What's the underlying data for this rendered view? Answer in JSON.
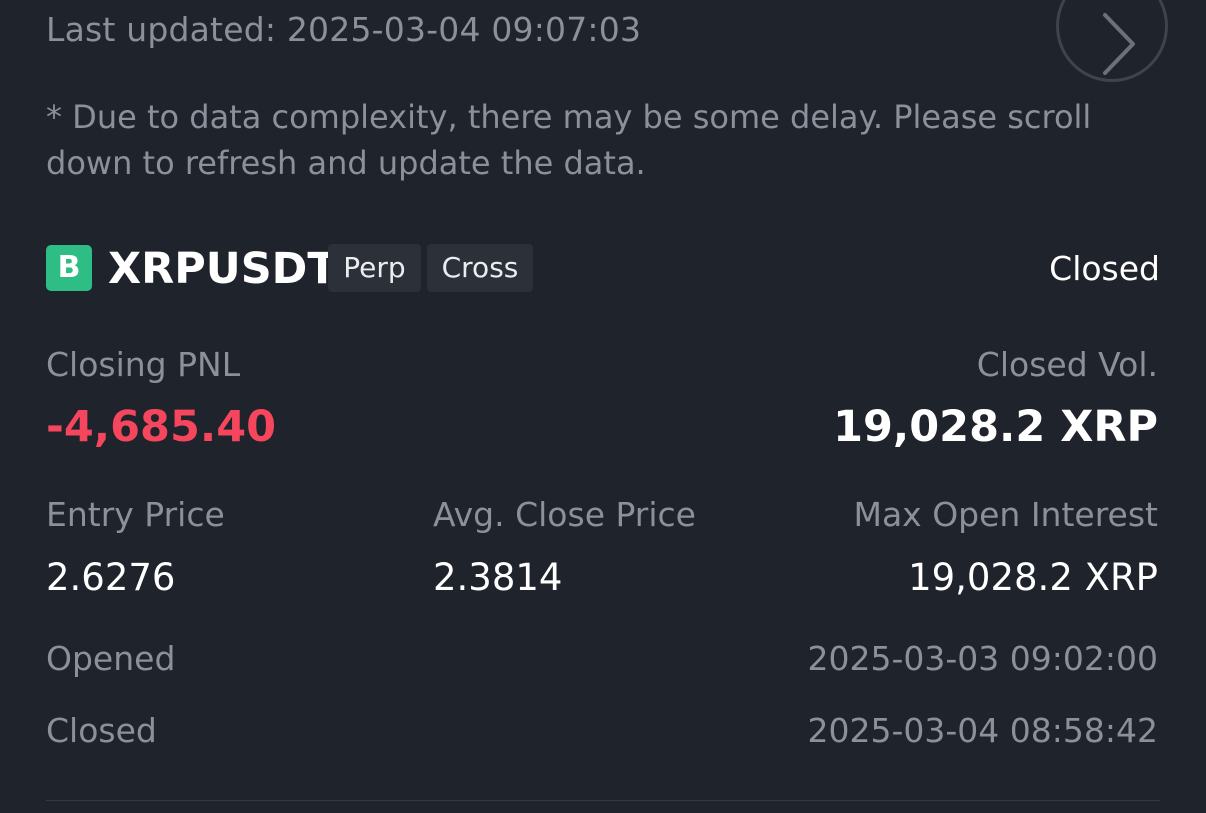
{
  "header": {
    "last_updated": "Last updated: 2025-03-04 09:07:03",
    "disclaimer": "* Due to data complexity, there may be some delay. Please scroll down to refresh and update the data."
  },
  "position": {
    "side_badge": "B",
    "symbol": "XRPUSDT",
    "tags": [
      "Perp",
      "Cross"
    ],
    "status": "Closed",
    "closing_pnl_label": "Closing PNL",
    "closing_pnl_value": "-4,685.40",
    "closed_vol_label": "Closed Vol.",
    "closed_vol_value": "19,028.2 XRP",
    "entry_price_label": "Entry Price",
    "entry_price_value": "2.6276",
    "avg_close_price_label": "Avg. Close Price",
    "avg_close_price_value": "2.3814",
    "max_open_interest_label": "Max Open Interest",
    "max_open_interest_value": "19,028.2 XRP",
    "opened_label": "Opened",
    "opened_value": "2025-03-03 09:02:00",
    "closed_label": "Closed",
    "closed_value": "2025-03-04 08:58:42"
  },
  "colors": {
    "background": "#1f232c",
    "buy_badge": "#2ebd85",
    "loss": "#f6465d",
    "muted_text": "#8b909a",
    "tag_bg": "#2b3039"
  },
  "icons": {
    "next": "chevron-right-icon"
  }
}
